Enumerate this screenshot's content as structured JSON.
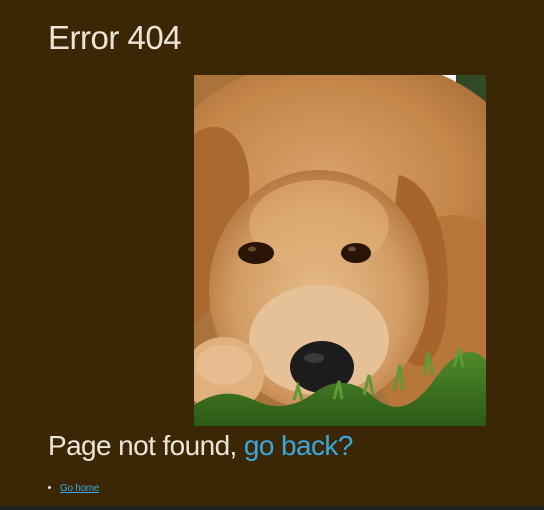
{
  "page": {
    "title": "Error 404",
    "message_prefix": "Page not found, ",
    "message_link": "go back?",
    "links": [
      {
        "label": "Go home"
      }
    ]
  },
  "image": {
    "subject": "golden-retriever-photo"
  },
  "colors": {
    "background": "#3b2606",
    "text": "#ece4d6",
    "link": "#3aa8dc"
  }
}
